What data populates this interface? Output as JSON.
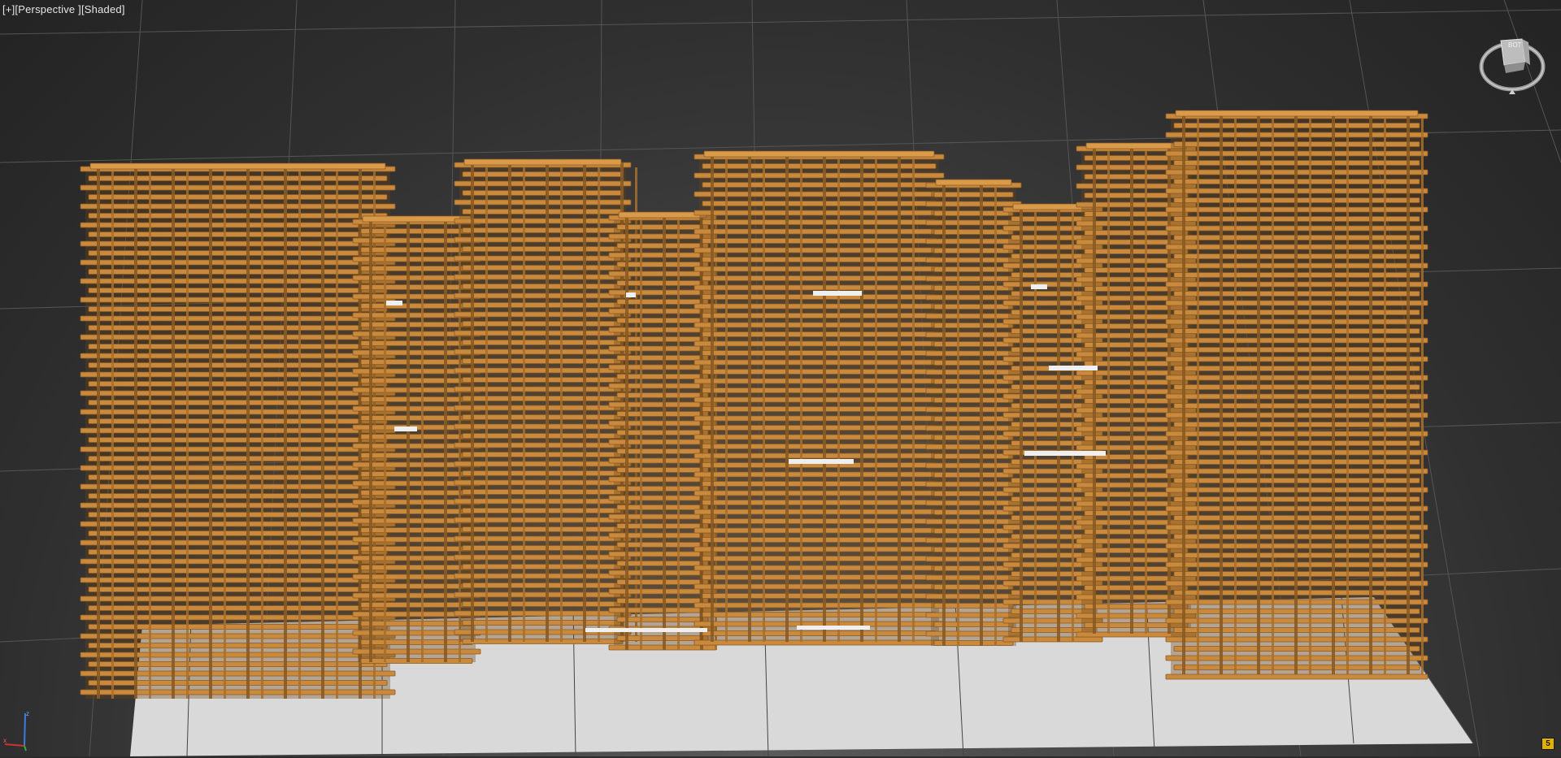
{
  "viewport": {
    "label_plus": "[+]",
    "label_view": "[Perspective ]",
    "label_shade": "[Shaded]",
    "background_color": "#2b2b2b",
    "grid_color": "#555555",
    "floor_color": "#d9d9d9",
    "rod_color": "#c98a3e",
    "rod_shadow_color": "#8a5a22"
  },
  "viewcube": {
    "icon": "viewcube-icon",
    "face_label": "BOT"
  },
  "axis_tripod": {
    "x_label": "x",
    "z_label": "z",
    "y_label": "y"
  },
  "corner_badge": {
    "label": "5"
  }
}
